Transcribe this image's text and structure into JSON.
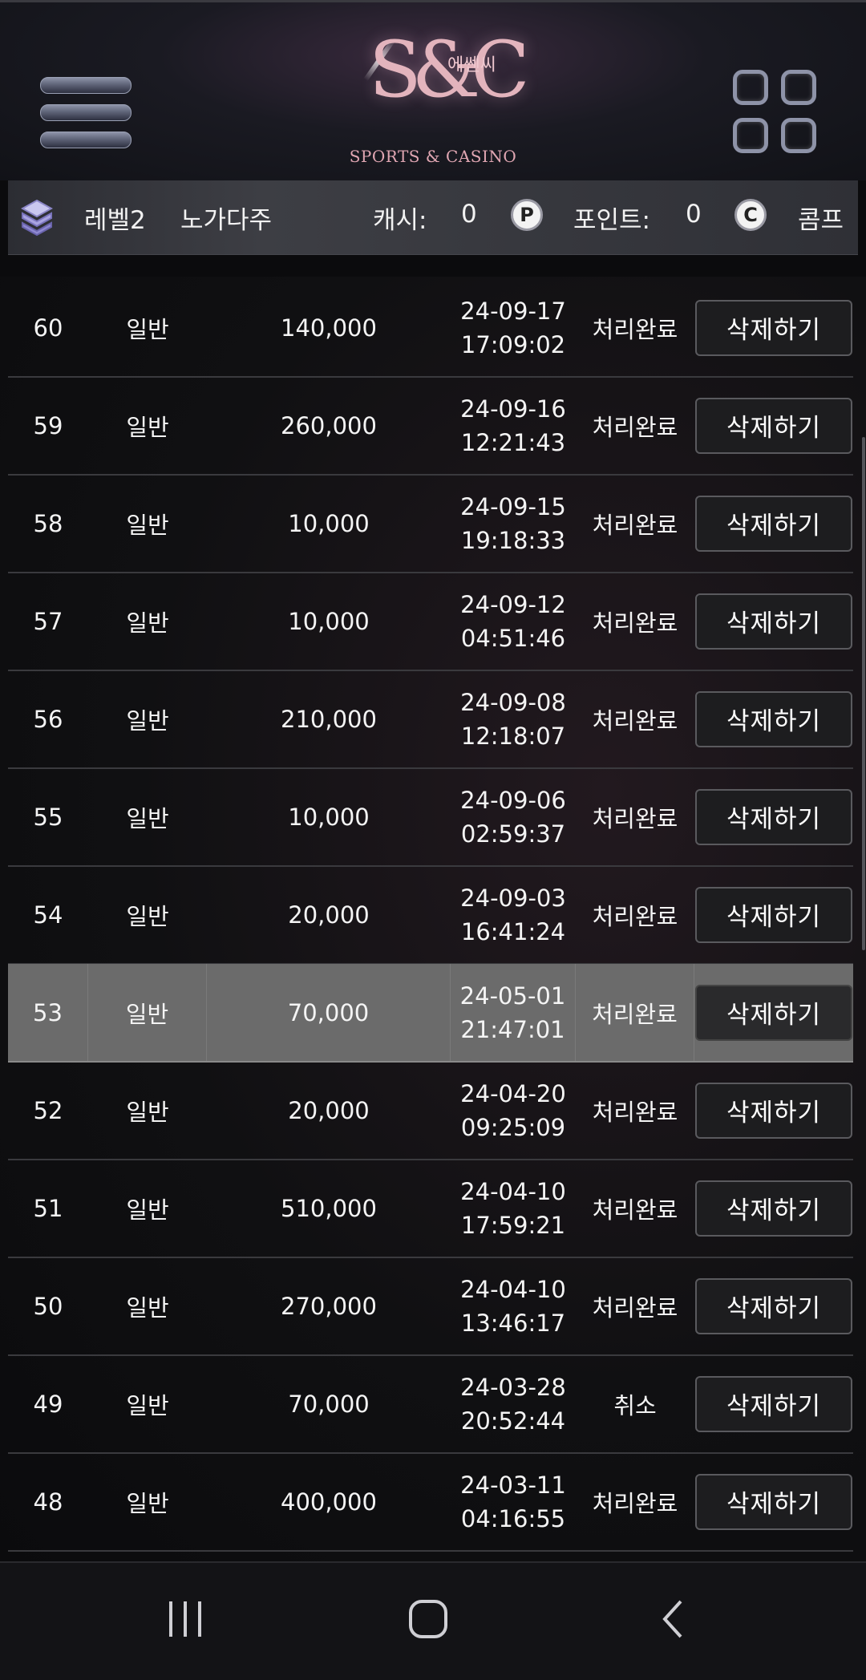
{
  "header": {
    "logo_mark": "S&C",
    "logo_korean": "에쎈씨",
    "logo_sub": "SPORTS & CASINO"
  },
  "info": {
    "level": "레벨2",
    "username": "노가다주",
    "cash_label": "캐시:",
    "cash_value": "0",
    "point_icon": "P",
    "point_label": "포인트:",
    "point_value": "0",
    "comp_icon": "C",
    "comp_label": "콤프"
  },
  "rows": [
    {
      "no": "60",
      "type": "일반",
      "amount": "140,000",
      "date": "24-09-17",
      "time": "17:09:02",
      "status": "처리완료",
      "action": "삭제하기"
    },
    {
      "no": "59",
      "type": "일반",
      "amount": "260,000",
      "date": "24-09-16",
      "time": "12:21:43",
      "status": "처리완료",
      "action": "삭제하기"
    },
    {
      "no": "58",
      "type": "일반",
      "amount": "10,000",
      "date": "24-09-15",
      "time": "19:18:33",
      "status": "처리완료",
      "action": "삭제하기"
    },
    {
      "no": "57",
      "type": "일반",
      "amount": "10,000",
      "date": "24-09-12",
      "time": "04:51:46",
      "status": "처리완료",
      "action": "삭제하기"
    },
    {
      "no": "56",
      "type": "일반",
      "amount": "210,000",
      "date": "24-09-08",
      "time": "12:18:07",
      "status": "처리완료",
      "action": "삭제하기"
    },
    {
      "no": "55",
      "type": "일반",
      "amount": "10,000",
      "date": "24-09-06",
      "time": "02:59:37",
      "status": "처리완료",
      "action": "삭제하기"
    },
    {
      "no": "54",
      "type": "일반",
      "amount": "20,000",
      "date": "24-09-03",
      "time": "16:41:24",
      "status": "처리완료",
      "action": "삭제하기"
    },
    {
      "no": "53",
      "type": "일반",
      "amount": "70,000",
      "date": "24-05-01",
      "time": "21:47:01",
      "status": "처리완료",
      "action": "삭제하기",
      "selected": true
    },
    {
      "no": "52",
      "type": "일반",
      "amount": "20,000",
      "date": "24-04-20",
      "time": "09:25:09",
      "status": "처리완료",
      "action": "삭제하기"
    },
    {
      "no": "51",
      "type": "일반",
      "amount": "510,000",
      "date": "24-04-10",
      "time": "17:59:21",
      "status": "처리완료",
      "action": "삭제하기"
    },
    {
      "no": "50",
      "type": "일반",
      "amount": "270,000",
      "date": "24-04-10",
      "time": "13:46:17",
      "status": "처리완료",
      "action": "삭제하기"
    },
    {
      "no": "49",
      "type": "일반",
      "amount": "70,000",
      "date": "24-03-28",
      "time": "20:52:44",
      "status": "취소",
      "action": "삭제하기"
    },
    {
      "no": "48",
      "type": "일반",
      "amount": "400,000",
      "date": "24-03-11",
      "time": "04:16:55",
      "status": "처리완료",
      "action": "삭제하기"
    }
  ],
  "colors": {
    "background": "#0b0b0d",
    "selected_row": "#6b6b6b",
    "button_bg": "#1d1d1f",
    "logo": "#e3b4bd"
  },
  "icons": [
    "hamburger-menu-icon",
    "grid-menu-icon",
    "level-gem-icon",
    "point-coin-icon",
    "comp-coin-icon",
    "recent-apps-icon",
    "home-icon",
    "back-icon"
  ]
}
